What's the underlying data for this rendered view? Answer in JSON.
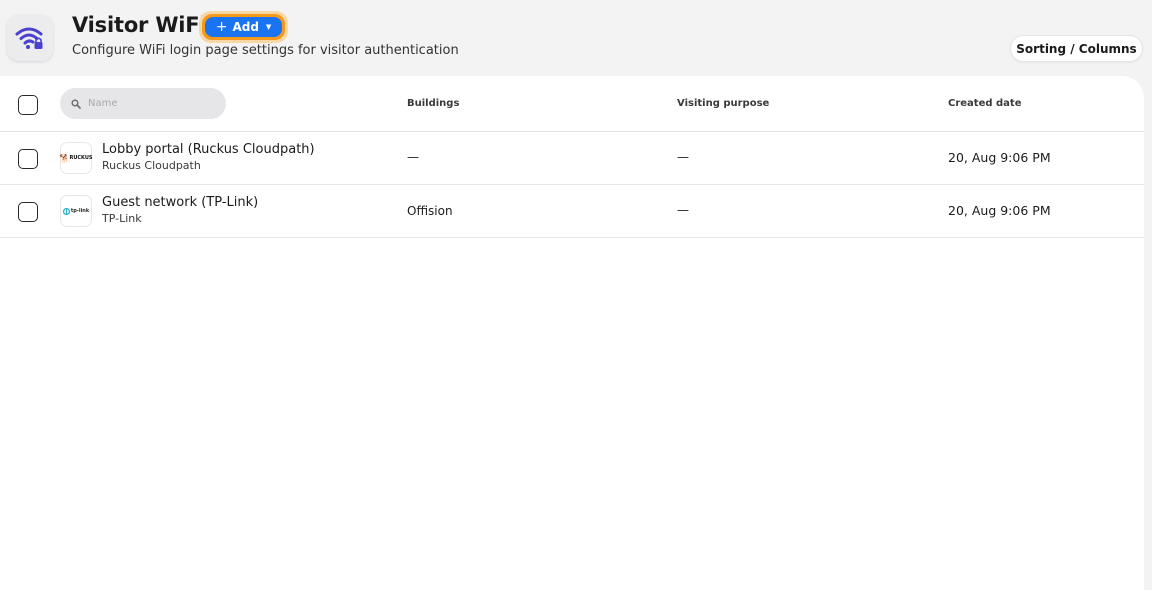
{
  "header": {
    "title": "Visitor WiFi",
    "add_label": "Add",
    "subtitle": "Configure WiFi login page settings for visitor authentication",
    "sort_label": "Sorting / Columns"
  },
  "search": {
    "placeholder": "Name"
  },
  "columns": {
    "buildings": "Buildings",
    "visiting_purpose": "Visiting purpose",
    "created_date": "Created date"
  },
  "rows": [
    {
      "name": "Lobby portal (Ruckus Cloudpath)",
      "vendor": "Ruckus Cloudpath",
      "logo_text": "RUCKUS",
      "buildings": "—",
      "visiting_purpose": "—",
      "created_date": "20, Aug 9:06 PM"
    },
    {
      "name": "Guest network (TP-Link)",
      "vendor": "TP-Link",
      "logo_text": "tp-link",
      "buildings": "Offision",
      "visiting_purpose": "—",
      "created_date": "20, Aug 9:06 PM"
    }
  ],
  "colors": {
    "accent": "#1a73f0",
    "focus_ring": "#f39a1c",
    "app_icon": "#4a3fcf"
  }
}
